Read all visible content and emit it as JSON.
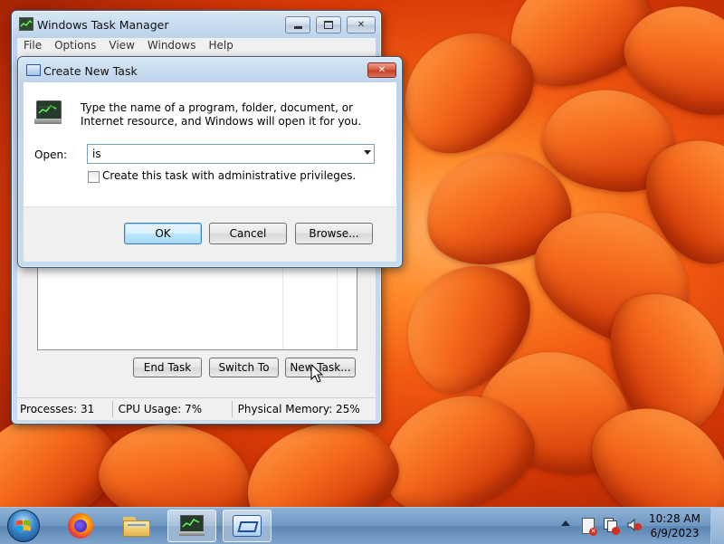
{
  "task_manager": {
    "title": "Windows Task Manager",
    "menu": [
      "File",
      "Options",
      "View",
      "Windows",
      "Help"
    ],
    "buttons": {
      "end_task": "End Task",
      "switch_to": "Switch To",
      "new_task": "New Task..."
    },
    "status": {
      "processes": "Processes: 31",
      "cpu": "CPU Usage: 7%",
      "memory": "Physical Memory: 25%"
    }
  },
  "dialog": {
    "title": "Create New Task",
    "description": "Type the name of a program, folder, document, or Internet resource, and Windows will open it for you.",
    "open_label": "Open:",
    "open_value": "is",
    "admin_label": "Create this task with administrative privileges.",
    "ok": "OK",
    "cancel": "Cancel",
    "browse": "Browse..."
  },
  "taskbar": {
    "time": "10:28 AM",
    "date": "6/9/2023",
    "items": [
      "start-orb",
      "firefox",
      "file-explorer",
      "task-manager",
      "create-new-task"
    ]
  },
  "colors": {
    "desktop": "#e8560f",
    "accent": "#3399ff"
  }
}
